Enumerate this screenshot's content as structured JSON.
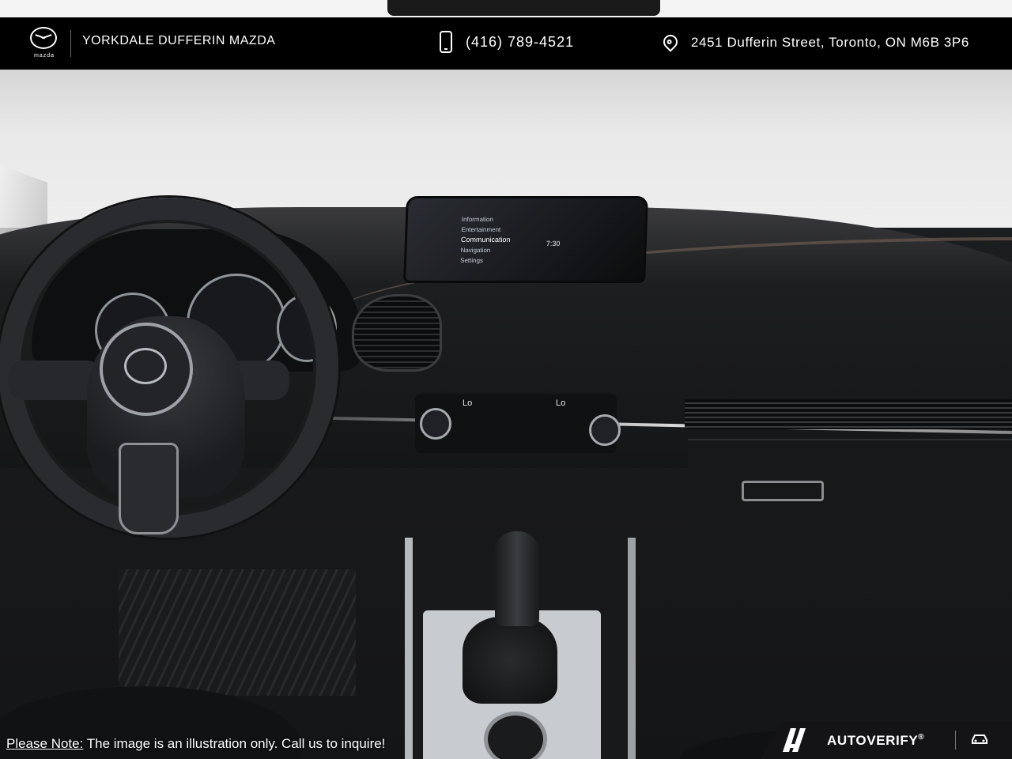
{
  "header": {
    "logo_word": "mazda",
    "dealer_name": "YORKDALE DUFFERIN MAZDA",
    "phone": "(416) 789-4521",
    "address": "2451 Dufferin Street, Toronto, ON M6B 3P6",
    "icons": {
      "phone": "phone-icon",
      "location": "map-pin-icon",
      "logo": "mazda-logo-icon"
    }
  },
  "photo": {
    "infotainment_menu": [
      "Information",
      "Entertainment",
      "Communication",
      "Navigation",
      "Settings"
    ],
    "infotainment_clock": "7:30",
    "climate_left": "Lo",
    "climate_right": "Lo"
  },
  "footer": {
    "note_label": "Please Note:",
    "note_text": " The image is an illustration only. Call us to inquire!",
    "badge_text": "AUTOVERIFY",
    "badge_mark": "®",
    "icons": {
      "badge": "autoverify-logo-icon",
      "vehicle": "car-icon"
    }
  },
  "colors": {
    "header_bg": "#000000",
    "header_text": "#ffffff"
  }
}
